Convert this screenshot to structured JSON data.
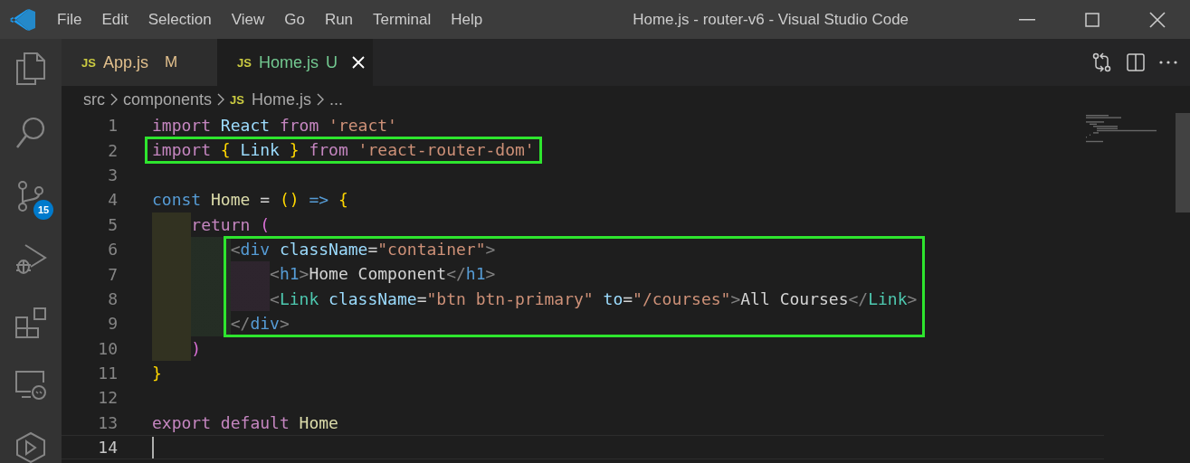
{
  "window": {
    "title": "Home.js - router-v6 - Visual Studio Code"
  },
  "menu": [
    "File",
    "Edit",
    "Selection",
    "View",
    "Go",
    "Run",
    "Terminal",
    "Help"
  ],
  "activity_bar": [
    {
      "kind": "explorer"
    },
    {
      "kind": "search"
    },
    {
      "kind": "source-control",
      "badge": "15"
    },
    {
      "kind": "run-debug"
    },
    {
      "kind": "extensions"
    },
    {
      "kind": "remote"
    },
    {
      "kind": "deploy"
    }
  ],
  "tabs": [
    {
      "icon_label": "JS",
      "label": "App.js",
      "color": "#e2c08d",
      "status_letter": "M",
      "selected": false
    },
    {
      "icon_label": "JS",
      "label": "Home.js",
      "color": "#73c991",
      "status_letter": "U",
      "selected": true
    }
  ],
  "breadcrumb": [
    {
      "label": "src"
    },
    {
      "label": "components"
    },
    {
      "icon_label": "JS",
      "label": "Home.js"
    },
    {
      "label": "..."
    }
  ],
  "lines": [
    {
      "number": "1",
      "boxed": false,
      "current": false,
      "tokens": [
        {
          "kind": "kw",
          "text": "import"
        },
        {
          "kind": "var",
          "text": " React"
        },
        {
          "kind": "kw",
          "text": " from"
        },
        {
          "kind": "str",
          "text": " 'react'"
        }
      ]
    },
    {
      "number": "2",
      "boxed": true,
      "current": false,
      "tokens": [
        {
          "kind": "kw",
          "text": "import"
        },
        {
          "kind": "b1",
          "text": " {"
        },
        {
          "kind": "var",
          "text": " Link"
        },
        {
          "kind": "b1",
          "text": " }"
        },
        {
          "kind": "kw",
          "text": " from"
        },
        {
          "kind": "str",
          "text": " 'react-router-dom'"
        }
      ]
    },
    {
      "number": "3",
      "boxed": false,
      "current": false
    },
    {
      "number": "4",
      "boxed": false,
      "current": false,
      "tokens": [
        {
          "kind": "store",
          "text": "const"
        },
        {
          "kind": "fn",
          "text": " Home"
        },
        {
          "kind": "p",
          "text": " ="
        },
        {
          "kind": "b1",
          "text": " ()"
        },
        {
          "kind": "store",
          "text": " =>"
        },
        {
          "kind": "b1",
          "text": " {"
        }
      ]
    },
    {
      "number": "5",
      "boxed": false,
      "current": false,
      "tokens": [
        {
          "kind": "kw",
          "text": "    return"
        },
        {
          "kind": "b2",
          "text": " ("
        }
      ]
    },
    {
      "number": "6",
      "boxed": true,
      "current": false,
      "tokens": [
        {
          "kind": "punc",
          "text": "        <"
        },
        {
          "kind": "tag",
          "text": "div"
        },
        {
          "kind": "attr",
          "text": " className"
        },
        {
          "kind": "p",
          "text": "="
        },
        {
          "kind": "str",
          "text": "\"container\""
        },
        {
          "kind": "punc",
          "text": ">"
        }
      ]
    },
    {
      "number": "7",
      "boxed": true,
      "current": false,
      "tokens": [
        {
          "kind": "punc",
          "text": "            <"
        },
        {
          "kind": "tag",
          "text": "h1"
        },
        {
          "kind": "punc",
          "text": ">"
        },
        {
          "kind": "p",
          "text": "Home Component"
        },
        {
          "kind": "punc",
          "text": "</"
        },
        {
          "kind": "tag",
          "text": "h1"
        },
        {
          "kind": "punc",
          "text": ">"
        }
      ]
    },
    {
      "number": "8",
      "boxed": true,
      "current": false,
      "tokens": [
        {
          "kind": "punc",
          "text": "            <"
        },
        {
          "kind": "comp",
          "text": "Link"
        },
        {
          "kind": "attr",
          "text": " className"
        },
        {
          "kind": "p",
          "text": "="
        },
        {
          "kind": "str",
          "text": "\"btn btn-primary\""
        },
        {
          "kind": "attr",
          "text": " to"
        },
        {
          "kind": "p",
          "text": "="
        },
        {
          "kind": "str",
          "text": "\"/courses\""
        },
        {
          "kind": "punc",
          "text": ">"
        },
        {
          "kind": "p",
          "text": "All Courses"
        },
        {
          "kind": "punc",
          "text": "</"
        },
        {
          "kind": "comp",
          "text": "Link"
        },
        {
          "kind": "punc",
          "text": ">"
        }
      ]
    },
    {
      "number": "9",
      "boxed": true,
      "current": false,
      "tokens": [
        {
          "kind": "punc",
          "text": "        </"
        },
        {
          "kind": "tag",
          "text": "div"
        },
        {
          "kind": "punc",
          "text": ">"
        }
      ]
    },
    {
      "number": "10",
      "boxed": false,
      "current": false,
      "tokens": [
        {
          "kind": "b2",
          "text": "    )"
        }
      ]
    },
    {
      "number": "11",
      "boxed": false,
      "current": false,
      "tokens": [
        {
          "kind": "b1",
          "text": "}"
        }
      ]
    },
    {
      "number": "12",
      "boxed": false,
      "current": false
    },
    {
      "number": "13",
      "boxed": false,
      "current": false,
      "tokens": [
        {
          "kind": "kw",
          "text": "export"
        },
        {
          "kind": "kw",
          "text": " default"
        },
        {
          "kind": "fn",
          "text": " Home"
        }
      ]
    },
    {
      "number": "14",
      "boxed": false,
      "current": true
    }
  ]
}
